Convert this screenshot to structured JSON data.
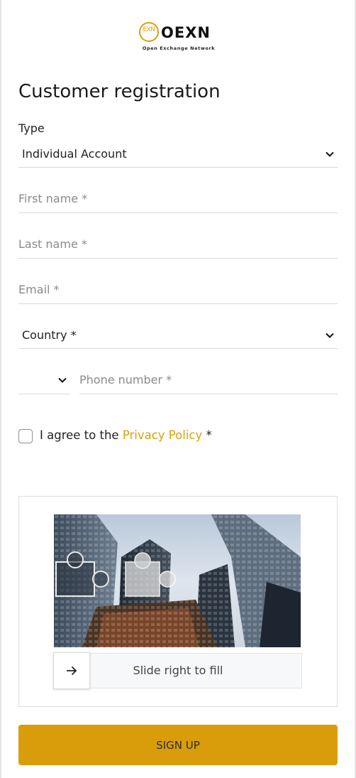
{
  "brand": {
    "logo_mark_text": "EXN",
    "logo_word": "OEXN",
    "tagline": "Open Exchange Network",
    "accent_color": "#d99d0b"
  },
  "page": {
    "title": "Customer registration"
  },
  "form": {
    "type_label": "Type",
    "type_value": "Individual Account",
    "first_name_placeholder": "First name *",
    "last_name_placeholder": "Last name *",
    "email_placeholder": "Email *",
    "country_value": "Country *",
    "phone_code_value": "",
    "phone_placeholder": "Phone number *",
    "agree_prefix": "I agree to the ",
    "privacy_link": "Privacy Policy",
    "agree_suffix": " *",
    "agree_checked": false
  },
  "captcha": {
    "slider_text": "Slide right to fill",
    "handle_icon": "arrow-right-icon",
    "slider_position_fraction": 0
  },
  "actions": {
    "signup_label": "SIGN UP"
  }
}
